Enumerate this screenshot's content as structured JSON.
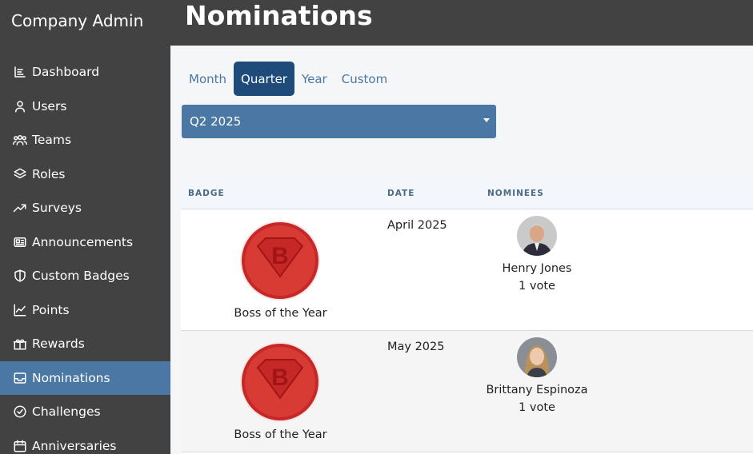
{
  "app": {
    "brand": "Company Admin"
  },
  "page": {
    "title": "Nominations"
  },
  "sidebar": {
    "items": [
      {
        "label": "Dashboard",
        "icon": "dashboard-icon"
      },
      {
        "label": "Users",
        "icon": "user-icon"
      },
      {
        "label": "Teams",
        "icon": "teams-icon"
      },
      {
        "label": "Roles",
        "icon": "layers-icon"
      },
      {
        "label": "Surveys",
        "icon": "trend-icon"
      },
      {
        "label": "Announcements",
        "icon": "newspaper-icon"
      },
      {
        "label": "Custom Badges",
        "icon": "shield-icon"
      },
      {
        "label": "Points",
        "icon": "chart-line-icon"
      },
      {
        "label": "Rewards",
        "icon": "gift-icon"
      },
      {
        "label": "Nominations",
        "icon": "inbox-icon",
        "active": true
      },
      {
        "label": "Challenges",
        "icon": "check-circle-icon"
      },
      {
        "label": "Anniversaries",
        "icon": "calendar-icon"
      }
    ]
  },
  "period_tabs": [
    {
      "label": "Month"
    },
    {
      "label": "Quarter",
      "active": true
    },
    {
      "label": "Year"
    },
    {
      "label": "Custom"
    }
  ],
  "period_select": {
    "value": "Q2 2025"
  },
  "table": {
    "headers": {
      "badge": "BADGE",
      "date": "DATE",
      "nominees": "NOMINEES"
    },
    "rows": [
      {
        "badge": "Boss of the Year",
        "date": "April 2025",
        "nominee": "Henry Jones",
        "votes": "1 vote"
      },
      {
        "badge": "Boss of the Year",
        "date": "May 2025",
        "nominee": "Brittany Espinoza",
        "votes": "1 vote"
      }
    ]
  },
  "colors": {
    "sidebar": "#424242",
    "accent": "#4a77a3",
    "active_tab": "#1f4b7b",
    "badge_red": "#d32f2f"
  }
}
